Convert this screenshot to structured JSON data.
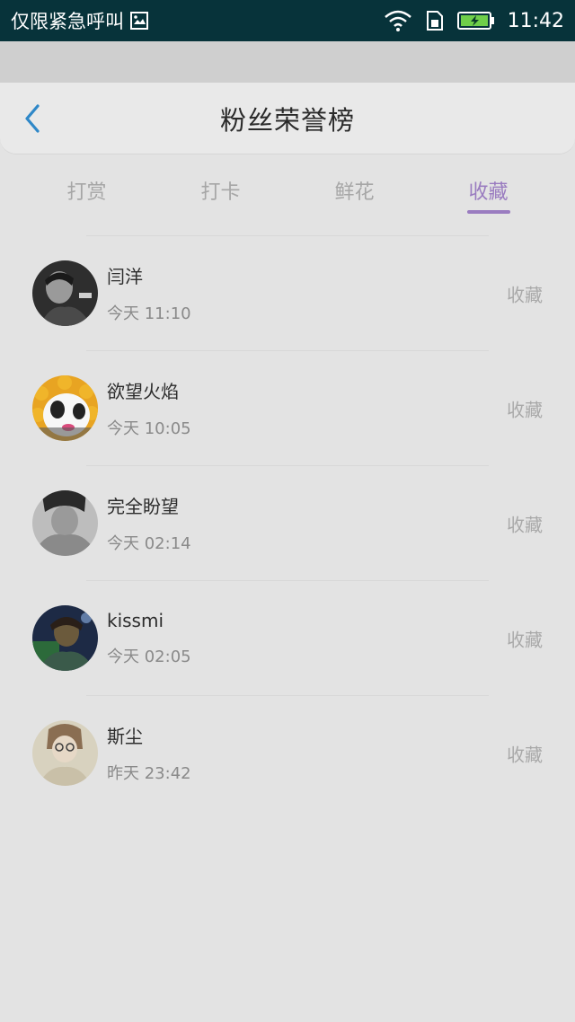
{
  "status_bar": {
    "carrier_text": "仅限紧急呼叫",
    "time": "11:42",
    "icons": [
      "image-icon",
      "wifi-icon",
      "sim-icon",
      "battery-charging-icon"
    ]
  },
  "header": {
    "title": "粉丝荣誉榜",
    "back_icon": "chevron-left-icon",
    "accent_color": "#2f88c8"
  },
  "tabs": [
    {
      "label": "打赏",
      "active": false
    },
    {
      "label": "打卡",
      "active": false
    },
    {
      "label": "鲜花",
      "active": false
    },
    {
      "label": "收藏",
      "active": true
    }
  ],
  "active_tab_color": "#9a7cc0",
  "fans": [
    {
      "name": "闫洋",
      "time": "今天 11:10",
      "action": "收藏"
    },
    {
      "name": "欲望火焰",
      "time": "今天 10:05",
      "action": "收藏"
    },
    {
      "name": "完全盼望",
      "time": "今天 02:14",
      "action": "收藏"
    },
    {
      "name": "kissmi",
      "time": "今天 02:05",
      "action": "收藏"
    },
    {
      "name": "斯尘",
      "time": "昨天 23:42",
      "action": "收藏"
    }
  ]
}
